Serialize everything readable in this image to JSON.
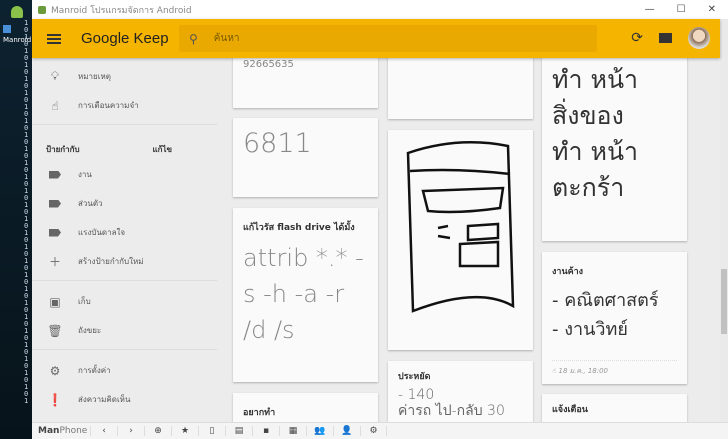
{
  "desktop": {
    "shortcut_label": "Manroid"
  },
  "window": {
    "title": "Manroid โปรแกรมจัดการ Android",
    "controls": [
      "—",
      "☐",
      "✕"
    ]
  },
  "header": {
    "brand_google": "Google",
    "brand_keep": "Keep",
    "search_placeholder": "ค้นหา",
    "refresh_icon": "⟳"
  },
  "sidebar": {
    "top_items": [
      {
        "label": "หมายเหตุ",
        "icon": "lightbulb-icon"
      },
      {
        "label": "การเตือนความจำ",
        "icon": "reminder-icon"
      }
    ],
    "labels_heading": "ป้ายกำกับ",
    "edit_label": "แก้ไข",
    "labels": [
      "งาน",
      "ส่วนตัว",
      "แรงบันดาลใจ"
    ],
    "create_label": "สร้างป้ายกำกับใหม่",
    "archive": "เก็บ",
    "trash": "ถังขยะ",
    "settings": "การตั้งค่า",
    "feedback": "ส่งความคิดเห็น"
  },
  "notes": {
    "n1": {
      "text": "92665635"
    },
    "n2": {
      "text": "6811"
    },
    "n3": {
      "title": "แก้ไวรัส flash drive ได้มั้ง",
      "text": "attrib *.* -s -h -a -r /d /s"
    },
    "n4": {
      "title": "อยากทำ"
    },
    "n6": {
      "title": "ประหยัด",
      "line1": "- 140",
      "line2": "ค่ารถ ไป-กลับ 30"
    },
    "n7": {
      "lines": [
        "ทำ หน้า",
        "สิ่งของ",
        "ทำ หน้า",
        "ตะกร้า"
      ]
    },
    "n8": {
      "title": "งานค้าง",
      "lines": [
        "- คณิตศาสตร์",
        "- งานวิทย์"
      ],
      "reminder": "18 ม.ค., 18:00"
    },
    "n9": {
      "title": "แจ้งเตือน"
    }
  },
  "bottombar": {
    "brand_man": "Man",
    "brand_phone": "Phone",
    "buttons": [
      "‹",
      "›",
      "⊕",
      "★",
      "▯",
      "▤",
      "▪",
      "▦",
      "👥",
      "👤",
      "⚙"
    ]
  }
}
